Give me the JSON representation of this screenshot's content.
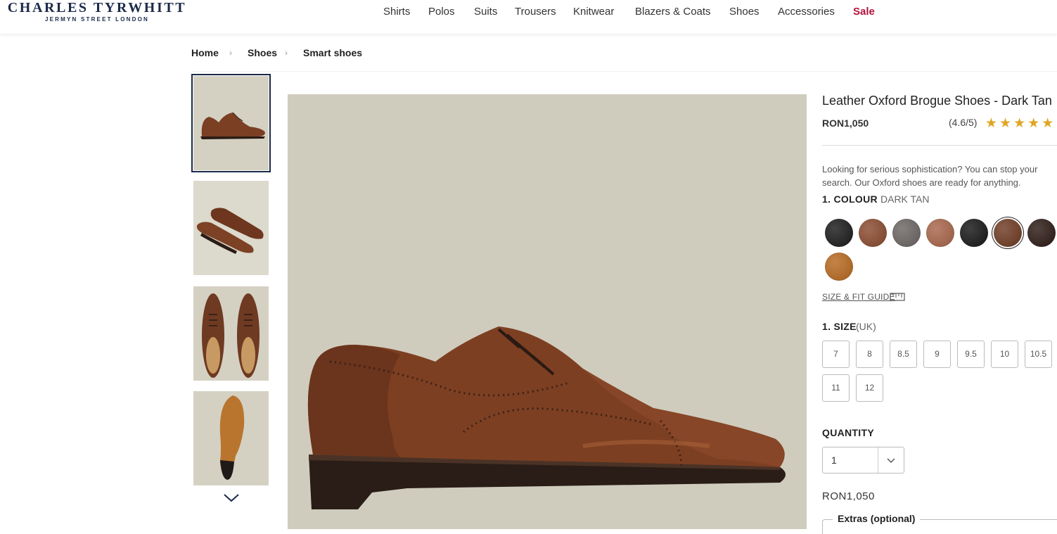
{
  "brand": {
    "name": "CHARLES TYRWHITT",
    "tagline": "JERMYN STREET LONDON",
    "color": "#1b2a4a"
  },
  "nav": {
    "items": [
      "Shirts",
      "Polos",
      "Suits",
      "Trousers",
      "Knitwear",
      "Blazers & Coats",
      "Shoes",
      "Accessories"
    ],
    "sale": "Sale",
    "sale_color": "#b3123a"
  },
  "breadcrumb": {
    "items": [
      "Home",
      "Shoes",
      "Smart shoes"
    ],
    "separator": "›"
  },
  "gallery": {
    "thumbnails": [
      "shoe-side-view",
      "shoe-angled-view",
      "shoe-pair-top-view",
      "shoe-sole-view"
    ],
    "active_index": 0,
    "next_icon": "chevron-down-icon",
    "background": "#cfccbd"
  },
  "product": {
    "title": "Leather Oxford Brogue Shoes - Dark Tan",
    "price": "RON1,050",
    "rating_text": "(4.6/5)",
    "stars": "★★★★★",
    "rating": 4.6,
    "description": "Looking for serious sophistication? You can stop your search. Our Oxford shoes are ready for anything."
  },
  "colour": {
    "label": "1. COLOUR",
    "selected": "DARK TAN",
    "swatches": [
      "#1a1a1a",
      "#8a4a2e",
      "#6b6563",
      "#a9654a",
      "#161616",
      "#6e3a22",
      "#2c1a14",
      "#b7691f"
    ],
    "selected_index": 5
  },
  "fit_guide": {
    "label": "SIZE & FIT GUIDE",
    "icon": "ruler-icon"
  },
  "size": {
    "label": "1. SIZE",
    "unit": "(UK)",
    "options": [
      "7",
      "8",
      "8.5",
      "9",
      "9.5",
      "10",
      "10.5",
      "11",
      "12"
    ]
  },
  "quantity": {
    "label": "QUANTITY",
    "value": "1",
    "icon": "chevron-down-icon"
  },
  "summary_price": "RON1,050",
  "extras": {
    "label": "Extras (optional)"
  }
}
